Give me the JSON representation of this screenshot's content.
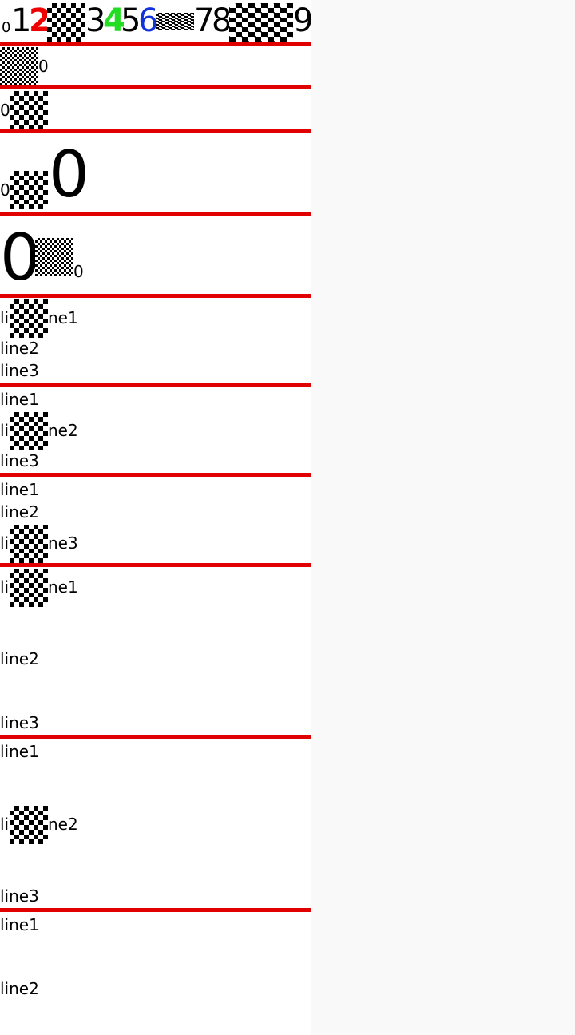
{
  "row1": {
    "digits": [
      "0",
      "1",
      "2",
      "3",
      "4",
      "5",
      "6",
      "7",
      "8",
      "9"
    ],
    "colors": {
      "red": "#ee0000",
      "green": "#22dd22",
      "blue": "#1133dd",
      "black": "#000000"
    }
  },
  "row2": {
    "text": "0"
  },
  "row3": {
    "text": "0"
  },
  "row4": {
    "small": "0",
    "big": "0"
  },
  "row5": {
    "big": "0",
    "small": "0"
  },
  "lines": {
    "line1": "line1",
    "line2": "line2",
    "line3": "line3",
    "li": "li",
    "ne1": "ne1",
    "ne2": "ne2",
    "ne3": "ne3"
  },
  "style": {
    "rule_color": "#e00000",
    "page_background": "#ffffff",
    "outer_background": "#f9f9f9"
  }
}
